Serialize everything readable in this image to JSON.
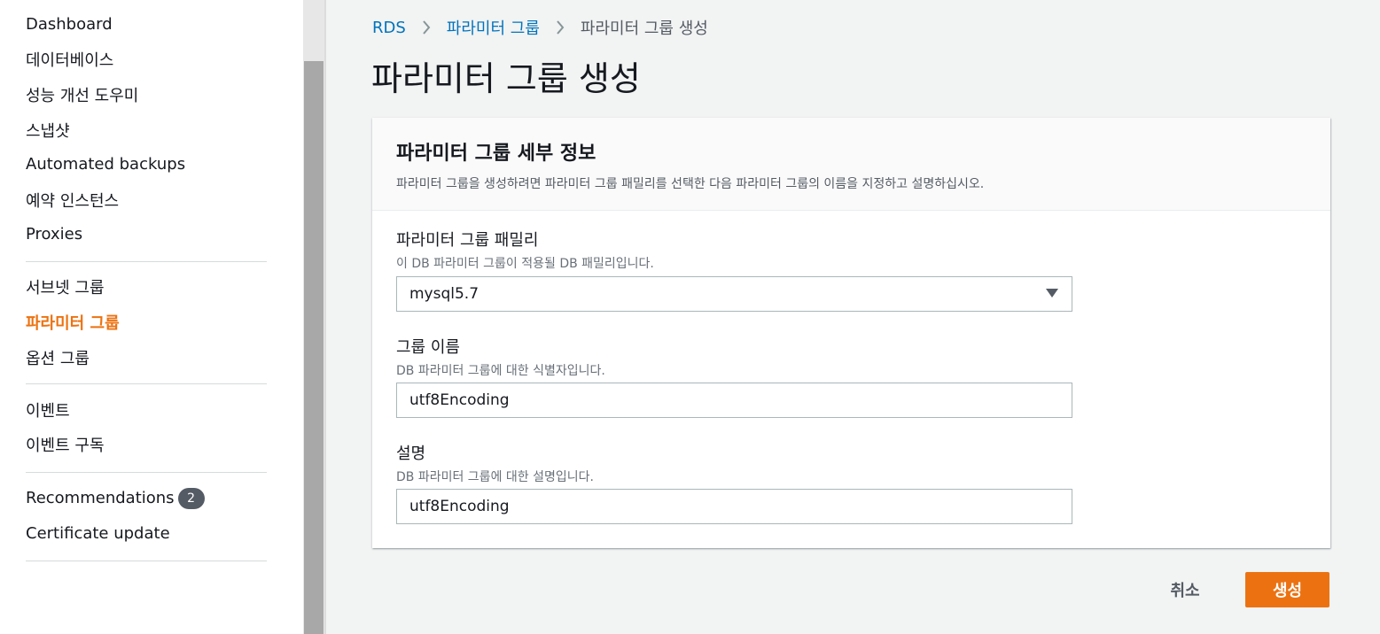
{
  "sidebar": {
    "items": [
      {
        "label": "Dashboard"
      },
      {
        "label": "데이터베이스"
      },
      {
        "label": "성능 개선 도우미"
      },
      {
        "label": "스냅샷"
      },
      {
        "label": "Automated backups"
      },
      {
        "label": "예약 인스턴스"
      },
      {
        "label": "Proxies"
      },
      {
        "label": "서브넷 그룹"
      },
      {
        "label": "파라미터 그룹",
        "active": true
      },
      {
        "label": "옵션 그룹"
      },
      {
        "label": "이벤트"
      },
      {
        "label": "이벤트 구독"
      },
      {
        "label": "Recommendations",
        "badge": "2"
      },
      {
        "label": "Certificate update"
      }
    ],
    "active_color": "#ec7211"
  },
  "breadcrumb": {
    "root": "RDS",
    "parent": "파라미터 그룹",
    "current": "파라미터 그룹 생성",
    "separator_icon": "chevron-right-icon"
  },
  "page": {
    "title": "파라미터 그룹 생성"
  },
  "panel": {
    "title": "파라미터 그룹 세부 정보",
    "description": "파라미터 그룹을 생성하려면 파라미터 그룹 패밀리를 선택한 다음 파라미터 그룹의 이름을 지정하고 설명하십시오."
  },
  "form": {
    "family": {
      "label": "파라미터 그룹 패밀리",
      "description": "이 DB 파라미터 그룹이 적용될 DB 패밀리입니다.",
      "selected": "mysql5.7",
      "icon": "caret-down-icon"
    },
    "name": {
      "label": "그룹 이름",
      "description": "DB 파라미터 그룹에 대한 식별자입니다.",
      "value": "utf8Encoding"
    },
    "desc": {
      "label": "설명",
      "description": "DB 파라미터 그룹에 대한 설명입니다.",
      "value": "utf8Encoding"
    }
  },
  "actions": {
    "cancel_label": "취소",
    "create_label": "생성",
    "primary_color": "#ec7211"
  }
}
